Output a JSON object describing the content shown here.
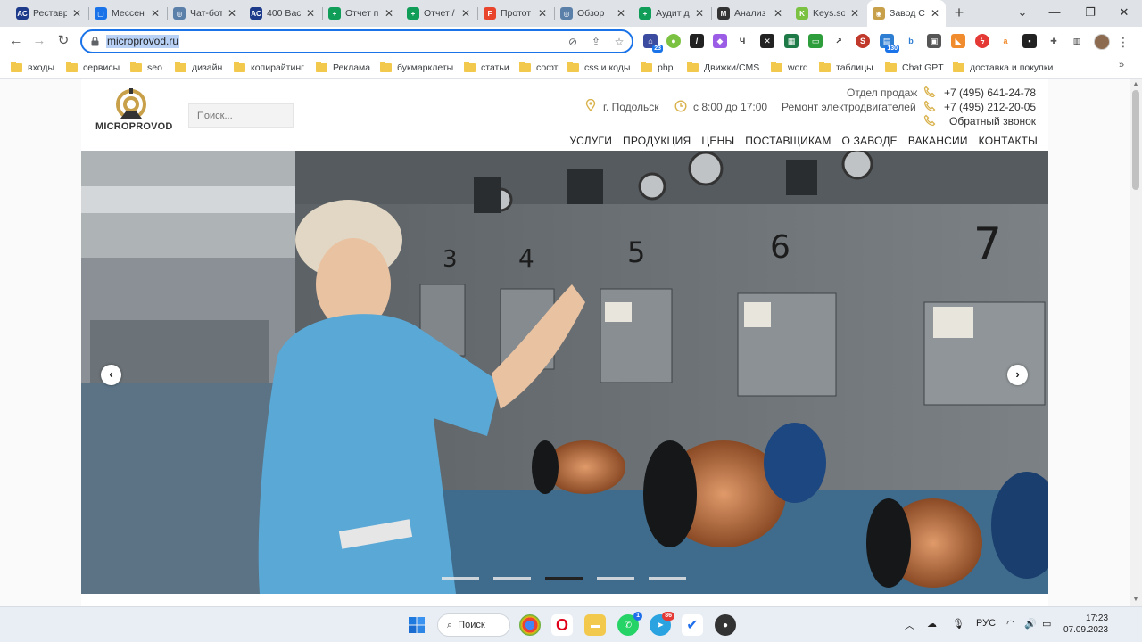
{
  "browser": {
    "tabs": [
      {
        "label": "Реставр",
        "icon": "ac-favicon",
        "color": "#1e3a8a",
        "glyph": "AC"
      },
      {
        "label": "Мессен",
        "icon": "chat-favicon",
        "color": "#1a73e8",
        "glyph": "▢"
      },
      {
        "label": "Чат-бот",
        "icon": "globe-favicon",
        "color": "#5a7fa8",
        "glyph": "◎"
      },
      {
        "label": "400 Вас",
        "icon": "ac-favicon",
        "color": "#1e3a8a",
        "glyph": "AC"
      },
      {
        "label": "Отчет п",
        "icon": "sheets-favicon",
        "color": "#0f9d58",
        "glyph": "+"
      },
      {
        "label": "Отчет /",
        "icon": "sheets-favicon",
        "color": "#0f9d58",
        "glyph": "+"
      },
      {
        "label": "Протот",
        "icon": "figma-favicon",
        "color": "#e8452c",
        "glyph": "F"
      },
      {
        "label": "Обзор",
        "icon": "globe-favicon",
        "color": "#5a7fa8",
        "glyph": "◎"
      },
      {
        "label": "Аудит д",
        "icon": "sheets-favicon",
        "color": "#0f9d58",
        "glyph": "+"
      },
      {
        "label": "Анализ",
        "icon": "m-favicon",
        "color": "#333333",
        "glyph": "M"
      },
      {
        "label": "Keys.so",
        "icon": "keys-favicon",
        "color": "#7cc242",
        "glyph": "K"
      },
      {
        "label": "Завод С",
        "icon": "microprovod-favicon",
        "color": "#c8a04a",
        "glyph": "◉"
      }
    ],
    "new_tab": "+",
    "url": "microprovod.ru"
  },
  "bookmarks": [
    "входы",
    "сервисы",
    "seo",
    "дизайн",
    "копирайтинг",
    "Реклама",
    "букмарклеты",
    "статьи",
    "софт",
    "css и коды",
    "php",
    "Движки/CMS",
    "word",
    "таблицы",
    "Chat GPT",
    "доставка и покупки"
  ],
  "site": {
    "logo_text": "MICROPROVOD",
    "search_placeholder": "Поиск...",
    "city": "г. Подольск",
    "hours": "с 8:00 до 17:00",
    "sales_label": "Отдел продаж",
    "repair_label": "Ремонт электродвигателей",
    "phone1": "+7 (495) 641-24-78",
    "phone2": "+7 (495) 212-20-05",
    "callback": "Обратный звонок",
    "menu": [
      "УСЛУГИ",
      "ПРОДУКЦИЯ",
      "ЦЕНЫ",
      "ПОСТАВЩИКАМ",
      "О ЗАВОДЕ",
      "ВАКАНСИИ",
      "КОНТАКТЫ"
    ],
    "gold": "#d9b24c",
    "slider": {
      "prev": "‹",
      "next": "›",
      "dots": 5,
      "active_dot": 3,
      "machine_numbers": [
        "3",
        "4",
        "5",
        "6",
        "7"
      ]
    }
  },
  "taskbar": {
    "search_label": "Поиск",
    "lang": "РУС",
    "time": "17:23",
    "date": "07.09.2023",
    "badge_whatsapp": "1",
    "badge_telegram": "86"
  }
}
